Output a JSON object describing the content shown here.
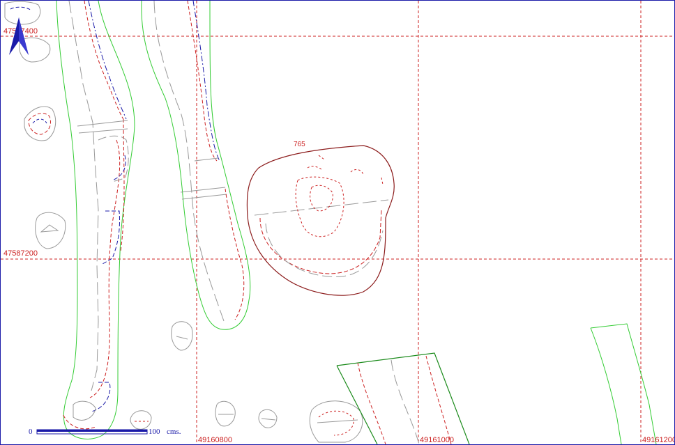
{
  "map": {
    "parcel_label": "765",
    "grid_labels": {
      "northing_top": "47587400",
      "northing_mid": "47587200",
      "easting_1": "49160800",
      "easting_2": "49161000",
      "easting_3": "49161200"
    },
    "scale_bar": {
      "start": "0",
      "end": "100",
      "unit": "cms."
    },
    "north_arrow_icon": "north-arrow-icon"
  },
  "colors": {
    "grid": "#cc2020",
    "parcel_outline": "#8b1a1a",
    "road_edge": "#33cc33",
    "gray_lines": "#8a8a8a",
    "blue_lines": "#1a1aa8",
    "frame": "#1a1aa8"
  }
}
